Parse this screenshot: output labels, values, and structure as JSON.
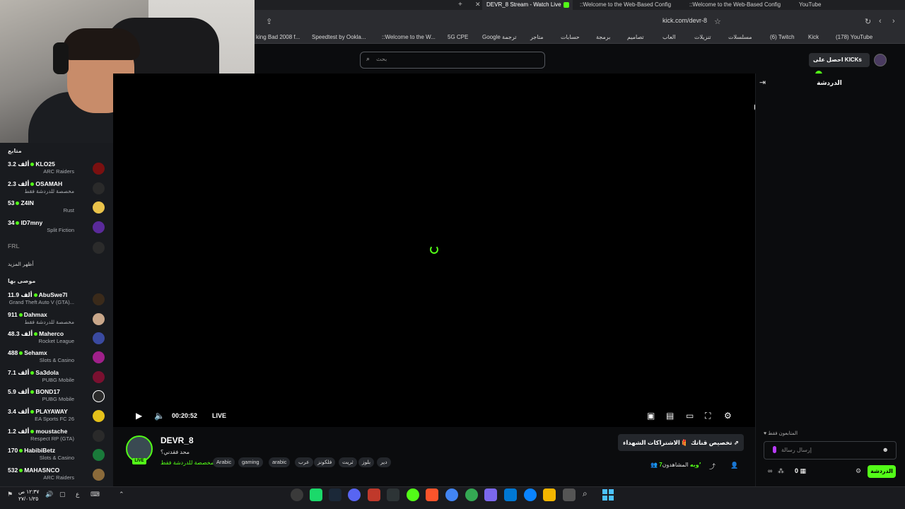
{
  "browser": {
    "tabs": [
      {
        "label": "DEVR_8 Stream - Watch Live",
        "active": true
      },
      {
        "label": "::Welcome to the Web-Based Config"
      },
      {
        "label": "::Welcome to the Web-Based Config"
      },
      {
        "label": "YouTube"
      }
    ],
    "url": "kick.com/devr-8",
    "bookmarks": [
      "king Bad 2008 f...",
      "Speedtest by Ookla...",
      "::Welcome to the W...",
      "5G CPE",
      "Google ترجمة",
      "متاجر",
      "حسابات",
      "برمجة",
      "تصاميم",
      "العاب",
      "تنزيلات",
      "مسلسلات",
      "(6) Twitch",
      "Kick",
      "(178) YouTube"
    ]
  },
  "header": {
    "search_placeholder": "بحث",
    "kicks_button": "احصل على KICKs"
  },
  "sidebar": {
    "following_title": "متابع",
    "following": [
      {
        "viewers": "3.2 ألف",
        "name": "KLO25",
        "category": "ARC Raiders",
        "color": "#7a1010"
      },
      {
        "viewers": "2.3 ألف",
        "name": "OSAMAH",
        "category": "مخصصة للدردشة فقط",
        "color": "#2a2a2a"
      },
      {
        "viewers": "53",
        "name": "Z4IN",
        "category": "Rust",
        "color": "#e9c24a"
      },
      {
        "viewers": "34",
        "name": "ID7mny",
        "category": "Split Fiction",
        "color": "#5a2a9a"
      }
    ],
    "offline": [
      {
        "name": "FRL",
        "color": "#2b2b2b"
      }
    ],
    "show_more": "أظهر المزيد",
    "recommended_title": "موصى بها",
    "recommended": [
      {
        "viewers": "11.9 ألف",
        "name": "AbuSwe7l",
        "category": "Grand Theft Auto V (GTA)...",
        "color": "#3a2a1a"
      },
      {
        "viewers": "911",
        "name": "Dahmax",
        "category": "مخصصة للدردشة فقط",
        "color": "#c9a78a"
      },
      {
        "viewers": "48.3 ألف",
        "name": "Maherco",
        "category": "Rocket League",
        "color": "#3a4aa0"
      },
      {
        "viewers": "488",
        "name": "Sehamx",
        "category": "Slots & Casino",
        "color": "#a0208a"
      },
      {
        "viewers": "7.1 ألف",
        "name": "Sa3dola",
        "category": "PUBG Mobile",
        "color": "#7a1030"
      },
      {
        "viewers": "5.9 ألف",
        "name": "BOND17",
        "category": "PUBG Mobile",
        "color": "#ffffff"
      },
      {
        "viewers": "3.4 ألف",
        "name": "PLAYAWAY",
        "category": "EA Sports FC 26",
        "color": "#e5c11a"
      },
      {
        "viewers": "1.2 ألف",
        "name": "moustache",
        "category": "Respect RP (GTA)",
        "color": "#2a2a2a"
      },
      {
        "viewers": "170",
        "name": "HabibiBetz",
        "category": "Slots & Casino",
        "color": "#1a7a3a"
      },
      {
        "viewers": "532",
        "name": "MAHASNCO",
        "category": "ARC Raiders",
        "color": "#8a6a3a"
      }
    ]
  },
  "player": {
    "time": "00:20:52",
    "live": "LIVE"
  },
  "stream": {
    "channel": "DEVR_8",
    "live_badge": "LIVE",
    "title": "محد فقدني؟",
    "category": "مخصصة للدردشة فقط",
    "tags": [
      "Arabic",
      "gaming",
      "arabic",
      "عرب",
      "فلكونز",
      "ثريت",
      "بلوز",
      "دير"
    ],
    "subs_button": "الاشتراكات الشهداء",
    "customize_button": "تخصيص قناتك",
    "viewers_label": "المشاهدون",
    "viewers_count": "7٬وبه"
  },
  "chat": {
    "title": "الدردشة",
    "followers_only": "المتابعون فقط",
    "input_placeholder": "إرسال رسالة",
    "send_label": "الدردشة",
    "coins": "0"
  },
  "taskbar": {
    "time": "١٢:٣٧ ص",
    "date": "٢٧/٠١/٢٥",
    "lang": "ع"
  }
}
